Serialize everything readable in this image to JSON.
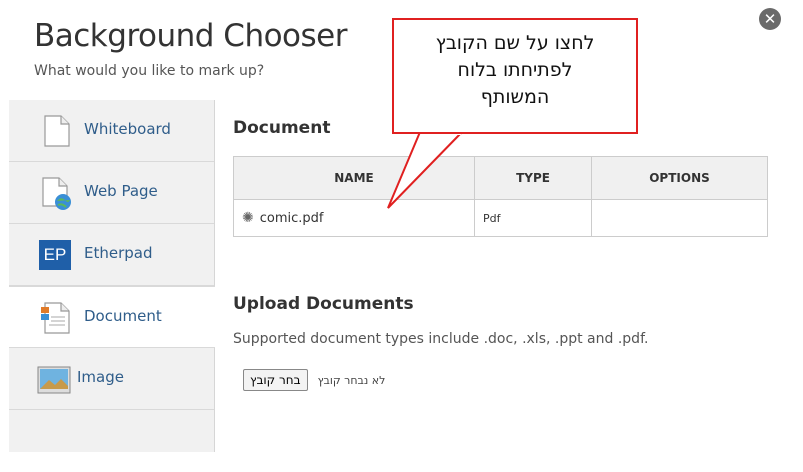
{
  "dialog": {
    "title": "Background Chooser",
    "subtitle": "What would you like to mark up?",
    "close_label": "✕"
  },
  "sidebar": {
    "items": [
      {
        "label": "Whiteboard",
        "icon": "page-icon"
      },
      {
        "label": "Web Page",
        "icon": "globe-page-icon"
      },
      {
        "label": "Etherpad",
        "icon": "ep-icon"
      },
      {
        "label": "Document",
        "icon": "document-icon"
      },
      {
        "label": "Image",
        "icon": "image-icon"
      }
    ],
    "active": "Document",
    "ep_badge": "EP"
  },
  "document_section": {
    "heading": "Document",
    "columns": [
      "NAME",
      "TYPE",
      "OPTIONS"
    ],
    "rows": [
      {
        "name": "comic.pdf",
        "type": "Pdf",
        "options": ""
      }
    ]
  },
  "upload_section": {
    "heading": "Upload Documents",
    "note": "Supported document types include .doc, .xls, .ppt and .pdf.",
    "button_label": "בחר קובץ",
    "no_file_text": "לא נבחר קובץ"
  },
  "callout": {
    "lines": [
      "לחצו על שם הקובץ",
      "לפתיחתו בלוח",
      "המשותף"
    ],
    "border_color": "#e02020"
  },
  "colors": {
    "link": "#2f5d8a",
    "sidebar_bg": "#f1f1f1"
  }
}
